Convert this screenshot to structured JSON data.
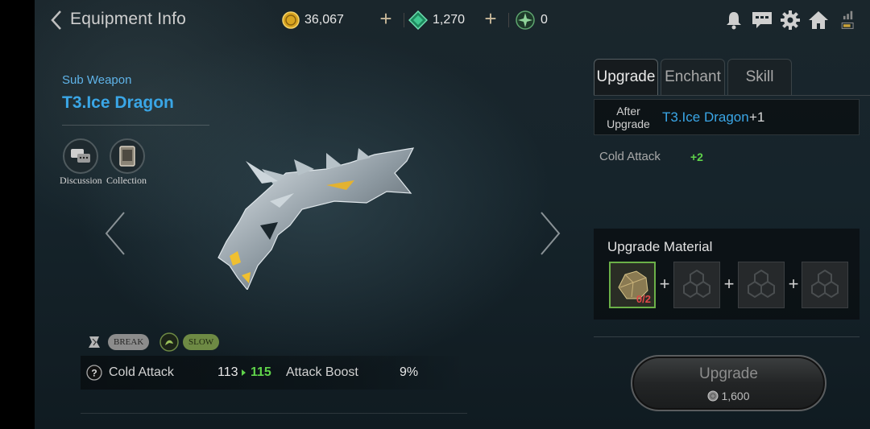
{
  "header": {
    "title": "Equipment Info",
    "gold": "36,067",
    "gems": "1,270",
    "tokens": "0"
  },
  "item": {
    "category": "Sub Weapon",
    "name": "T3.Ice Dragon",
    "actions": [
      {
        "label": "Discussion",
        "icon": "discussion-icon"
      },
      {
        "label": "Collection",
        "icon": "collection-icon"
      }
    ],
    "tags": [
      {
        "label": "BREAK",
        "icon": "break-icon",
        "color": "#8c8c8c"
      },
      {
        "label": "SLOW",
        "icon": "slow-icon",
        "color": "#6e8a44"
      }
    ],
    "stats": {
      "stat1_label": "Cold Attack",
      "stat1_current": "113",
      "stat1_next": "115",
      "stat2_label": "Attack Boost",
      "stat2_value": "9%"
    }
  },
  "tabs": [
    {
      "label": "Upgrade",
      "active": true
    },
    {
      "label": "Enchant",
      "active": false
    },
    {
      "label": "Skill",
      "active": false
    }
  ],
  "upgrade": {
    "after_label": "After Upgrade",
    "after_name": "T3.Ice Dragon",
    "after_level": "+1",
    "bonus_label": "Cold Attack",
    "bonus_value": "+2",
    "material_title": "Upgrade Material",
    "material_count": "0/2",
    "button_label": "Upgrade",
    "cost": "1,600"
  },
  "colors": {
    "item_name": "#3aa6e6",
    "bonus": "#5fd34a",
    "stat_next": "#5fd34a",
    "material_missing": "#e04848"
  }
}
